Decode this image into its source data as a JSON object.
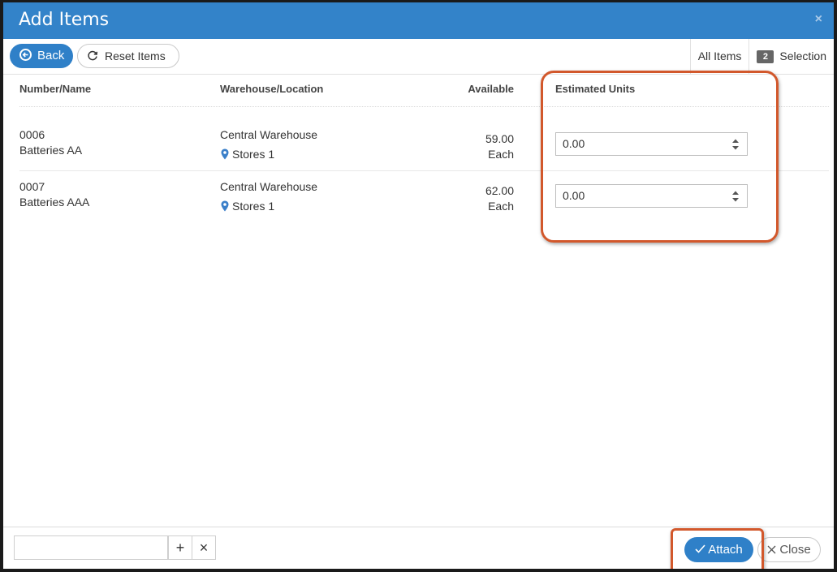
{
  "dialog": {
    "title": "Add Items",
    "close_glyph": "×"
  },
  "toolbar": {
    "back_label": "Back",
    "reset_label": "Reset Items",
    "all_items_label": "All Items",
    "selection_count": "2",
    "selection_label": "Selection"
  },
  "table": {
    "headers": {
      "number_name": "Number/Name",
      "warehouse_location": "Warehouse/Location",
      "available": "Available",
      "estimated_units": "Estimated Units"
    },
    "rows": [
      {
        "number": "0006",
        "name": "Batteries AA",
        "warehouse": "Central Warehouse",
        "location": "Stores 1",
        "available": "59.00",
        "unit": "Each",
        "estimated_units": "0.00"
      },
      {
        "number": "0007",
        "name": "Batteries AAA",
        "warehouse": "Central Warehouse",
        "location": "Stores 1",
        "available": "62.00",
        "unit": "Each",
        "estimated_units": "0.00"
      }
    ]
  },
  "footer": {
    "add_glyph": "+",
    "clear_glyph": "×",
    "attach_label": "Attach",
    "close_label": "Close"
  },
  "colors": {
    "primary": "#3383c9",
    "highlight": "#d2582c"
  },
  "icons": [
    "back-arrow-icon",
    "refresh-icon",
    "location-pin-icon",
    "spinner-icon",
    "check-icon",
    "close-icon",
    "plus-icon"
  ]
}
